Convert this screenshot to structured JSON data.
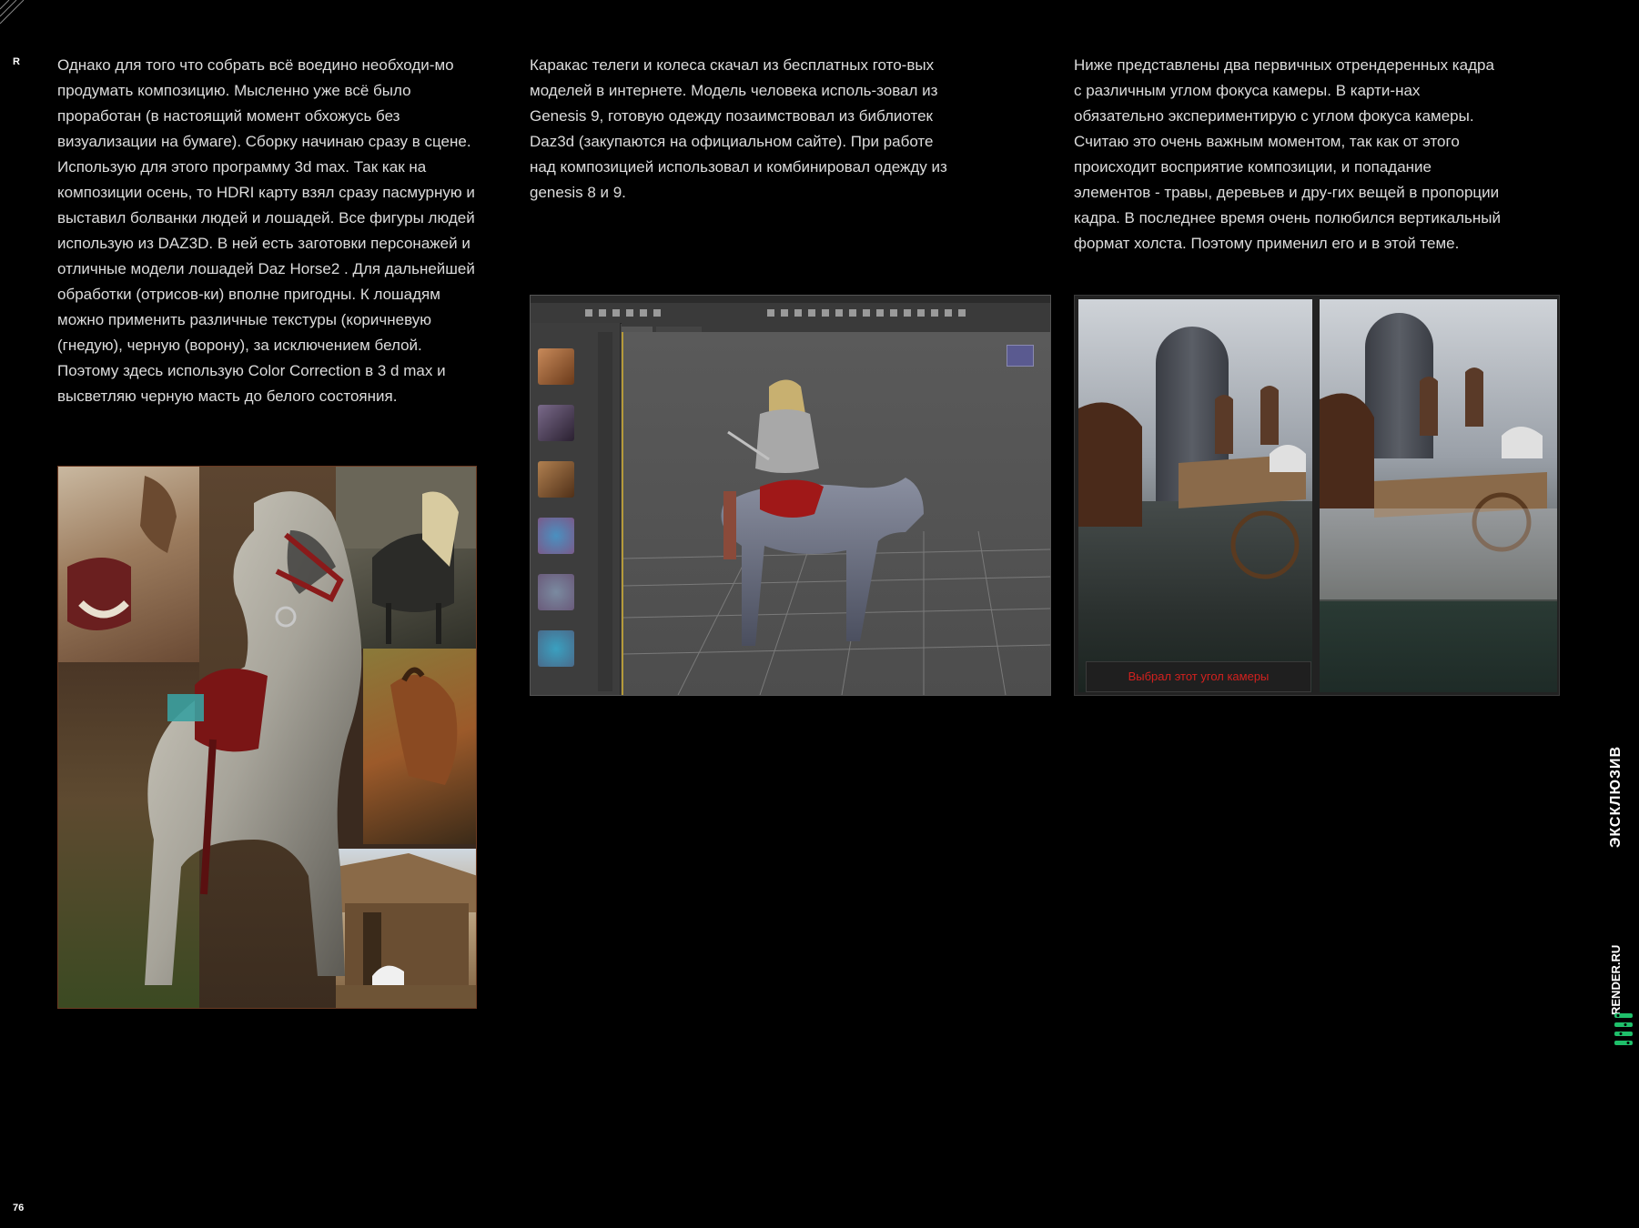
{
  "page": {
    "corner_mark": "R",
    "page_number": "76"
  },
  "columns": {
    "col1": "Однако для того что собрать всё воедино необходи-мо продумать композицию. Мысленно уже всё было проработан (в настоящий момент обхожусь без визуализации на бумаге). Сборку начинаю сразу в сцене. Использую для этого программу 3d max. Так как на композиции осень, то HDRI карту взял сразу пасмурную и выставил болванки людей и лошадей. Все фигуры людей использую из DAZ3D. В ней есть заготовки персонажей и отличные модели лошадей Daz Horse2 . Для дальнейшей обработки (отрисов-ки) вполне пригодны. К лошадям можно применить различные текстуры (коричневую (гнедую), черную (ворону), за исключением белой. Поэтому здесь использую Color Correction в 3 d max и высветляю черную масть до белого состояния.",
    "col2": "Каракас телеги и колеса скачал из бесплатных гото-вых моделей в интернете. Модель человека исполь-зовал из Genesis 9, готовую одежду позаимствовал из библиотек Daz3d (закупаются на официальном сайте). При работе над композицией использовал и комбинировал одежду из genesis 8 и 9.",
    "col3": "Ниже представлены два первичных отрендеренных кадра с различным углом фокуса камеры. В карти-нах обязательно экспериментирую с углом фокуса камеры. Считаю это очень важным моментом, так как от этого происходит восприятие композиции, и попадание элементов - травы, деревьев и дру-гих вещей в пропорции кадра. В последнее время очень полюбился вертикальный формат холста. Поэтому применил его и в этой теме."
  },
  "render_caption": "Выбрал этот угол камеры",
  "side": {
    "section": "ЭКСКЛЮЗИВ",
    "site": "RENDER.RU"
  },
  "colors": {
    "background": "#000000",
    "caption_red": "#d2211f",
    "logo_green": "#1fbf6a"
  }
}
